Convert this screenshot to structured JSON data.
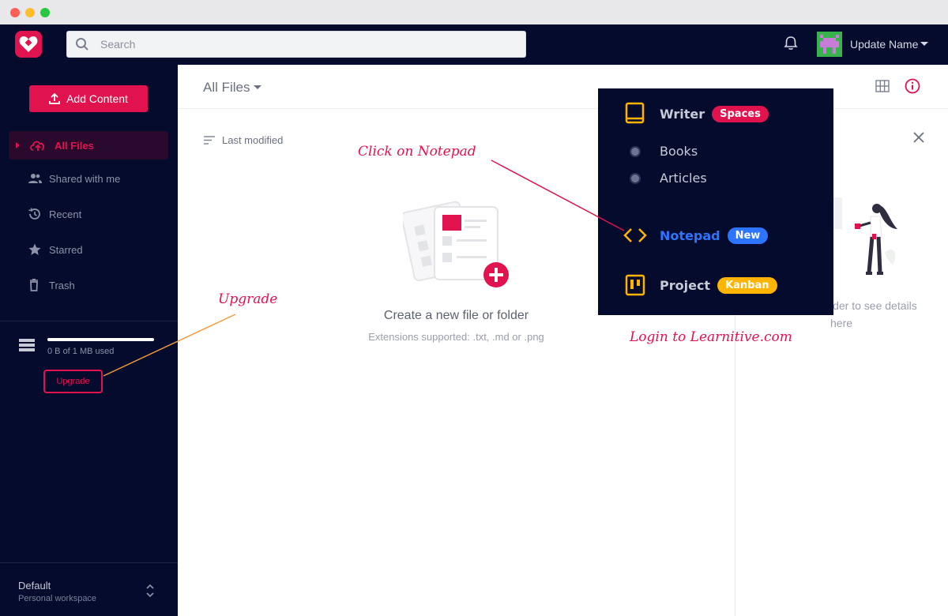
{
  "window": {
    "controls": [
      "close",
      "minimize",
      "maximize"
    ]
  },
  "header": {
    "search_placeholder": "Search",
    "user_name": "Update Name",
    "icons": [
      "search-icon",
      "bell-icon",
      "avatar",
      "chevron-down-icon"
    ]
  },
  "sidebar": {
    "add_button": "Add Content",
    "items": [
      {
        "label": "All Files",
        "icon": "cloud-upload-icon",
        "active": true
      },
      {
        "label": "Shared with me",
        "icon": "people-icon"
      },
      {
        "label": "Recent",
        "icon": "history-icon"
      },
      {
        "label": "Starred",
        "icon": "star-icon"
      },
      {
        "label": "Trash",
        "icon": "trash-icon"
      }
    ],
    "storage_text": "0 B of 1 MB used",
    "storage_used_fraction": 0,
    "upgrade_button": "Upgrade",
    "workspace_name": "Default",
    "workspace_sub": "Personal workspace"
  },
  "main": {
    "breadcrumb": "All Files",
    "sort_label": "Last modified",
    "empty_title": "Create a new file or folder",
    "empty_sub": "Extensions supported: .txt, .md or .png"
  },
  "details": {
    "text_line1": "lder to see details",
    "text_line2": "here"
  },
  "overlay": {
    "writer_label": "Writer",
    "writer_pill": "Spaces",
    "books_label": "Books",
    "articles_label": "Articles",
    "notepad_label": "Notepad",
    "notepad_pill": "New",
    "project_label": "Project",
    "project_pill": "Kanban"
  },
  "annotations": {
    "click_notepad": "Click on Notepad",
    "upgrade": "Upgrade",
    "login": "Login to Learnitive.com"
  },
  "colors": {
    "brand": "#e0134f",
    "dark": "#040b2c",
    "notepad_blue": "#2d74ff",
    "kanban_yellow": "#ffb400",
    "annotation_orange": "#f59a3a"
  }
}
